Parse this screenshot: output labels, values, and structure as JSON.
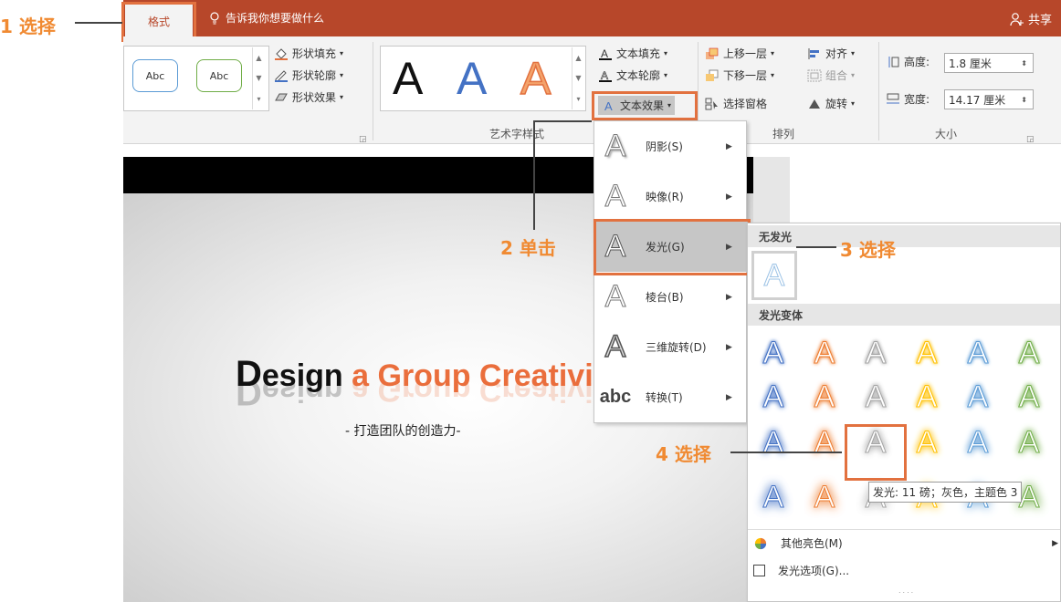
{
  "titlebar": {
    "tab_format": "格式",
    "tell_me": "告诉我你想要做什么",
    "share": "共享"
  },
  "ribbon": {
    "shape_styles": {
      "abc1": "Abc",
      "abc2": "Abc",
      "fill": "形状填充",
      "outline": "形状轮廓",
      "effects": "形状效果"
    },
    "wordart": {
      "letters": [
        "A",
        "A",
        "A"
      ],
      "text_fill": "文本填充",
      "text_outline": "文本轮廓",
      "text_effects": "文本效果",
      "group_label": "艺术字样式"
    },
    "arrange": {
      "bring_forward": "上移一层",
      "send_backward": "下移一层",
      "selection_pane": "选择窗格",
      "align": "对齐",
      "group": "组合",
      "rotate": "旋转",
      "group_label": "排列"
    },
    "size": {
      "height_label": "高度:",
      "height_value": "1.8 厘米",
      "width_label": "宽度:",
      "width_value": "14.17 厘米",
      "group_label": "大小"
    }
  },
  "slide": {
    "title_d": "D",
    "title_esign": "esign",
    "title_rest": " a  Group Creativity",
    "subtitle": "- 打造团队的创造力-"
  },
  "text_effects_menu": [
    {
      "label": "阴影(S)",
      "icon": "shadow-icon"
    },
    {
      "label": "映像(R)",
      "icon": "reflection-icon"
    },
    {
      "label": "发光(G)",
      "icon": "glow-icon"
    },
    {
      "label": "棱台(B)",
      "icon": "bevel-icon"
    },
    {
      "label": "三维旋转(D)",
      "icon": "3d-rotation-icon"
    },
    {
      "label": "转换(T)",
      "icon": "transform-icon"
    }
  ],
  "glow_panel": {
    "no_glow": "无发光",
    "variants": "发光变体",
    "tooltip": "发光: 11 磅；灰色，主题色 3",
    "more_colors": "其他亮色(M)",
    "glow_options": "发光选项(G)...",
    "glow_colors": [
      "#4472c4",
      "#ed7d31",
      "#a5a5a5",
      "#ffc000",
      "#5b9bd5",
      "#70ad47"
    ]
  },
  "annotations": {
    "step1": "1 选择",
    "step2": "2 单击",
    "step3": "3 选择",
    "step4": "4 选择"
  },
  "colors": {
    "accent": "#b7472a",
    "highlight": "#e2713f",
    "annotation": "#f08a32"
  }
}
